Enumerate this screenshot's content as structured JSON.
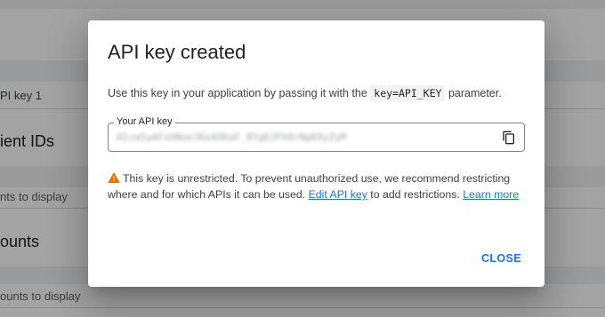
{
  "background": {
    "api_key_row": "PI key 1",
    "client_ids_heading": "ient IDs",
    "client_ids_empty": "nts to display",
    "accounts_heading": "ounts",
    "accounts_empty": "ounts to display"
  },
  "dialog": {
    "title": "API key created",
    "description_before": "Use this key in your application by passing it with the ",
    "description_code": "key=API_KEY",
    "description_after": " parameter.",
    "key_field": {
      "label": "Your API key",
      "value": "AIzaSyAFxHNoeJKo4XKaF_8YgDJFh0rNpK9yZyM"
    },
    "copy_icon": "copy-icon",
    "warning": {
      "icon": "warning-icon",
      "text_before": "This key is unrestricted. To prevent unauthorized use, we recommend restricting where and for which APIs it can be used. ",
      "edit_link": "Edit API key",
      "text_middle": " to add restrictions. ",
      "learn_link": "Learn more"
    },
    "close_label": "CLOSE"
  },
  "colors": {
    "accent": "#1a73e8",
    "warning": "#e37400"
  }
}
